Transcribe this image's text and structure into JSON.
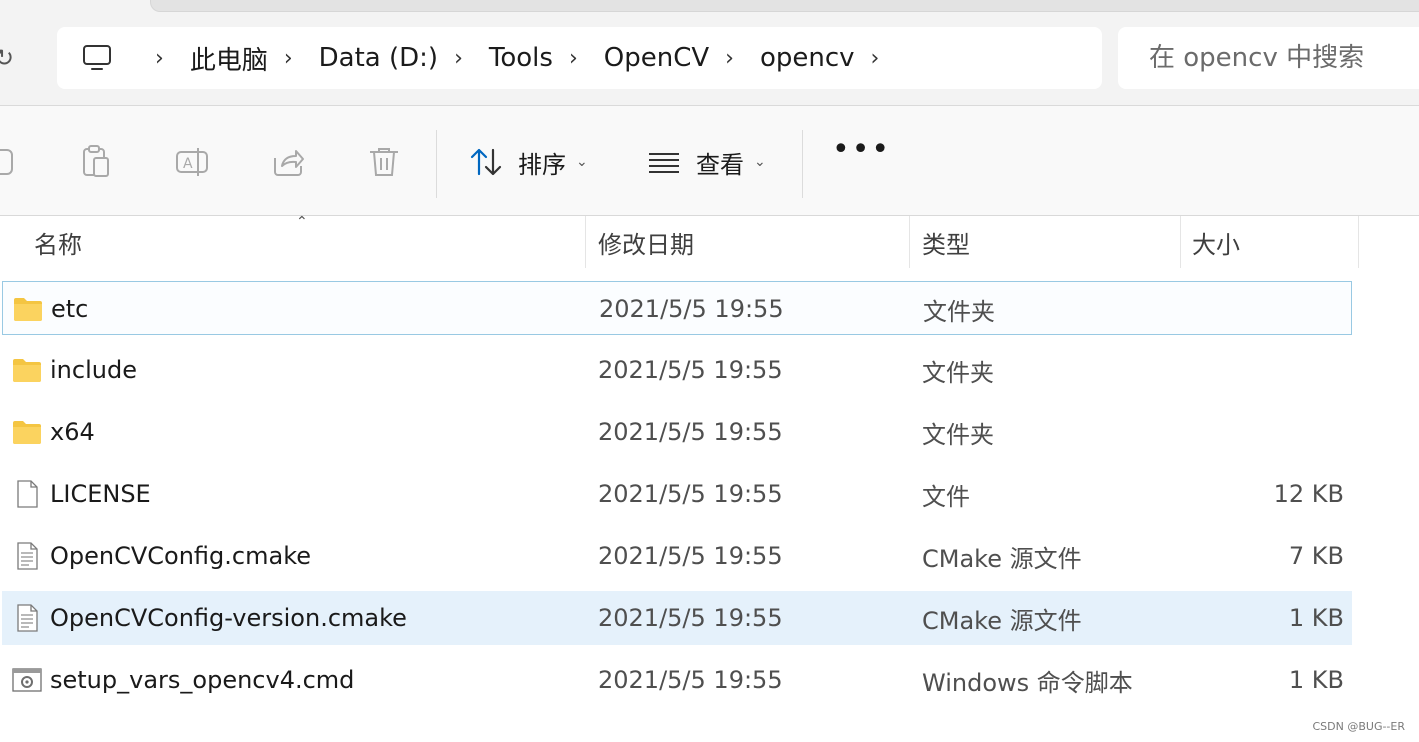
{
  "address": {
    "crumbs": [
      "此电脑",
      "Data (D:)",
      "Tools",
      "OpenCV",
      "opencv"
    ],
    "pc_icon": "computer-icon"
  },
  "search": {
    "placeholder": "在 opencv 中搜索"
  },
  "toolbar": {
    "sort_label": "排序",
    "view_label": "查看",
    "more_label": "•••",
    "icons": [
      "new-icon",
      "paste-icon",
      "rename-icon",
      "share-icon",
      "delete-icon"
    ]
  },
  "columns": {
    "name": "名称",
    "date": "修改日期",
    "type": "类型",
    "size": "大小"
  },
  "files": [
    {
      "name": "etc",
      "date": "2021/5/5 19:55",
      "type": "文件夹",
      "size": "",
      "icon": "folder-icon"
    },
    {
      "name": "include",
      "date": "2021/5/5 19:55",
      "type": "文件夹",
      "size": "",
      "icon": "folder-icon"
    },
    {
      "name": "x64",
      "date": "2021/5/5 19:55",
      "type": "文件夹",
      "size": "",
      "icon": "folder-icon"
    },
    {
      "name": "LICENSE",
      "date": "2021/5/5 19:55",
      "type": "文件",
      "size": "12 KB",
      "icon": "file-icon"
    },
    {
      "name": "OpenCVConfig.cmake",
      "date": "2021/5/5 19:55",
      "type": "CMake 源文件",
      "size": "7 KB",
      "icon": "text-file-icon"
    },
    {
      "name": "OpenCVConfig-version.cmake",
      "date": "2021/5/5 19:55",
      "type": "CMake 源文件",
      "size": "1 KB",
      "icon": "text-file-icon"
    },
    {
      "name": "setup_vars_opencv4.cmd",
      "date": "2021/5/5 19:55",
      "type": "Windows 命令脚本",
      "size": "1 KB",
      "icon": "script-file-icon"
    }
  ],
  "watermark": "CSDN @BUG--ER",
  "colors": {
    "accent": "#0067c0",
    "folder": "#f4c542",
    "selection_border": "#99c9e3",
    "hover": "#e5f1fb"
  }
}
